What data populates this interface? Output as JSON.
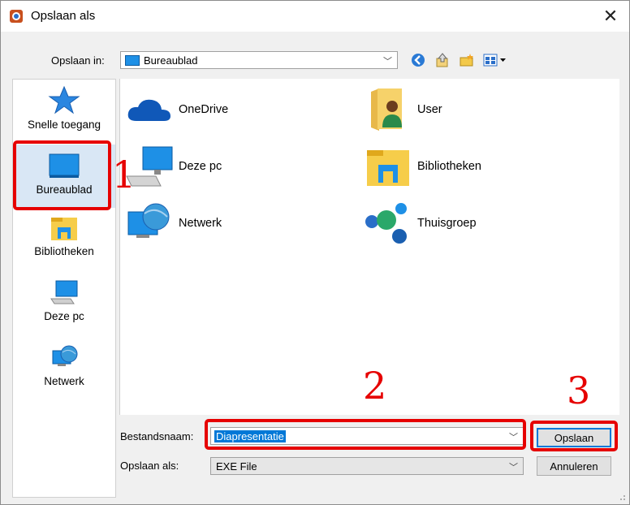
{
  "window": {
    "title": "Opslaan als",
    "close_glyph": "✕"
  },
  "location": {
    "label": "Opslaan in:",
    "value": "Bureaublad"
  },
  "places": [
    {
      "label": "Snelle toegang",
      "icon": "star-icon"
    },
    {
      "label": "Bureaublad",
      "icon": "desktop-icon",
      "selected": true
    },
    {
      "label": "Bibliotheken",
      "icon": "libraries-icon"
    },
    {
      "label": "Deze pc",
      "icon": "pc-icon"
    },
    {
      "label": "Netwerk",
      "icon": "network-icon"
    }
  ],
  "items": [
    {
      "label": "OneDrive",
      "icon": "onedrive-icon"
    },
    {
      "label": "User",
      "icon": "user-folder-icon"
    },
    {
      "label": "Deze pc",
      "icon": "pc-icon"
    },
    {
      "label": "Bibliotheken",
      "icon": "libraries-icon"
    },
    {
      "label": "Netwerk",
      "icon": "network-icon"
    },
    {
      "label": "Thuisgroep",
      "icon": "homegroup-icon"
    }
  ],
  "filename": {
    "label": "Bestandsnaam:",
    "value": "Diapresentatie"
  },
  "filetype": {
    "label": "Opslaan als:",
    "value": "EXE File"
  },
  "buttons": {
    "save": "Opslaan",
    "cancel": "Annuleren"
  },
  "annotations": {
    "one": "1",
    "two": "2",
    "three": "3"
  },
  "colors": {
    "annotation": "#e60000",
    "accent": "#0078d7",
    "selection": "#d9e7f5"
  }
}
